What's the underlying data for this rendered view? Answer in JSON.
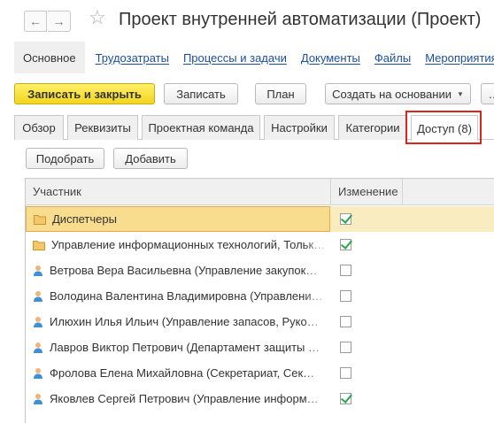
{
  "window": {
    "title": "Проект внутренней автоматизации (Проект)",
    "nav_back_icon": "arrow-left-icon",
    "nav_forward_icon": "arrow-right-icon",
    "favorite_icon": "star-icon"
  },
  "sections": {
    "active": "Основное",
    "links": [
      "Трудозатраты",
      "Процессы и задачи",
      "Документы",
      "Файлы",
      "Мероприятия"
    ]
  },
  "toolbar": {
    "save_close": "Записать и закрыть",
    "save": "Записать",
    "plan": "План",
    "create_based": "Создать на основании",
    "more": "…"
  },
  "tabs": [
    "Обзор",
    "Реквизиты",
    "Проектная команда",
    "Настройки",
    "Категории",
    "Доступ (8)"
  ],
  "active_tab": "Доступ (8)",
  "access_toolbar": {
    "pick": "Подобрать",
    "add": "Добавить"
  },
  "table": {
    "columns": [
      "Участник",
      "Изменение"
    ],
    "rows": [
      {
        "icon": "folder-icon",
        "participant": "Диспетчеры",
        "can_edit": true,
        "selected": true
      },
      {
        "icon": "folder-icon",
        "participant": "Управление информационных технологий, Тольк…",
        "can_edit": true,
        "selected": false
      },
      {
        "icon": "user-icon",
        "participant": "Ветрова Вера Васильевна (Управление закупок…",
        "can_edit": false,
        "selected": false
      },
      {
        "icon": "user-icon",
        "participant": "Володина Валентина Владимировна (Управлени…",
        "can_edit": false,
        "selected": false
      },
      {
        "icon": "user-icon",
        "participant": "Илюхин Илья Ильич (Управление запасов, Руко…",
        "can_edit": false,
        "selected": false
      },
      {
        "icon": "user-icon",
        "participant": "Лавров Виктор Петрович (Департамент защиты …",
        "can_edit": false,
        "selected": false
      },
      {
        "icon": "user-icon",
        "participant": "Фролова Елена Михайловна (Секретариат, Сек…",
        "can_edit": false,
        "selected": false
      },
      {
        "icon": "user-icon",
        "participant": "Яковлев Сергей Петрович (Управление информ…",
        "can_edit": true,
        "selected": false
      }
    ]
  },
  "colors": {
    "accent_button": "#f2d51c",
    "selected_row": "#faecc1",
    "link": "#1a4f9e",
    "highlight": "#d9261c",
    "check": "#2aa54a"
  }
}
